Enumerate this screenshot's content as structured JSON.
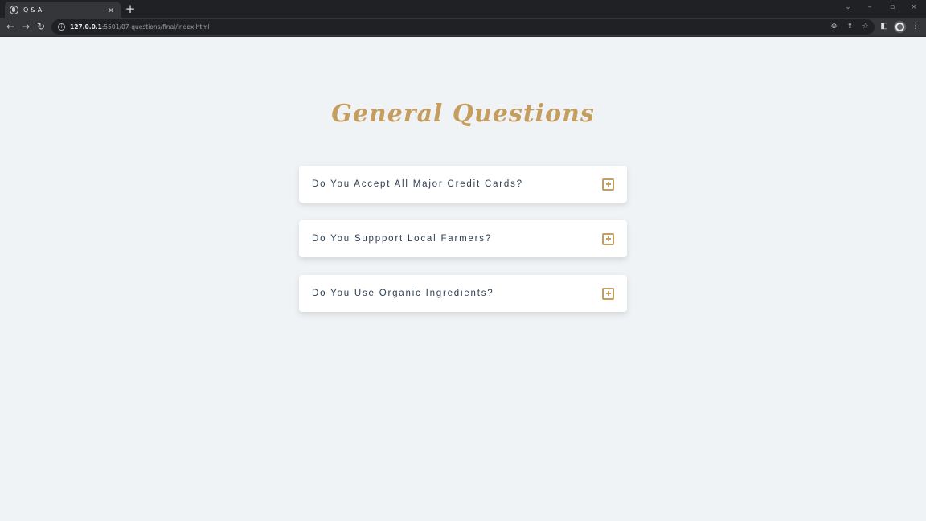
{
  "browser": {
    "tab_title": "Q & A",
    "tab_close": "×",
    "new_tab": "+",
    "url_host": "127.0.0.1",
    "url_rest": ":5501/07-questions/final/index.html",
    "window_controls": [
      "⌄",
      "–",
      "▫",
      "×"
    ],
    "icons": [
      "back-icon",
      "forward-icon",
      "reload-icon",
      "info-icon",
      "zoom-icon",
      "share-icon",
      "bookmark-star-icon",
      "side-panel-icon",
      "profile-avatar-icon",
      "more-menu-icon"
    ]
  },
  "page": {
    "title": "General Questions",
    "questions": [
      {
        "text": "Do You Accept All Major Credit Cards?"
      },
      {
        "text": "Do You Suppport Local Farmers?"
      },
      {
        "text": "Do You Use Organic Ingredients?"
      }
    ]
  },
  "colors": {
    "accent": "#c59d5f",
    "page_bg": "#f0f3f5",
    "question_text": "#2c3e50",
    "card_bg": "#ffffff"
  }
}
